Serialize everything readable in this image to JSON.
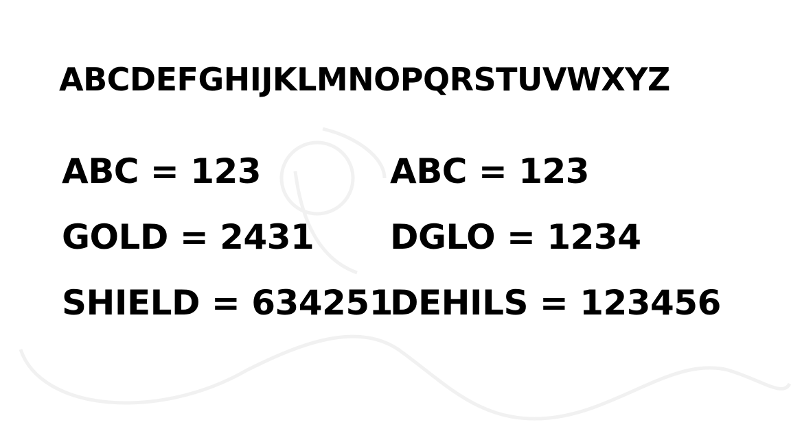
{
  "alphabet": "ABCDEFGHIJKLMNOPQRSTUVWXYZ",
  "left_column": [
    "ABC = 123",
    "GOLD = 2431",
    "SHIELD = 634251"
  ],
  "right_column": [
    "ABC = 123",
    "DGLO = 1234",
    "DEHILS = 123456"
  ],
  "colors": {
    "background": "#ffffff",
    "text": "#000000",
    "watermark": "#f1f1f1"
  }
}
